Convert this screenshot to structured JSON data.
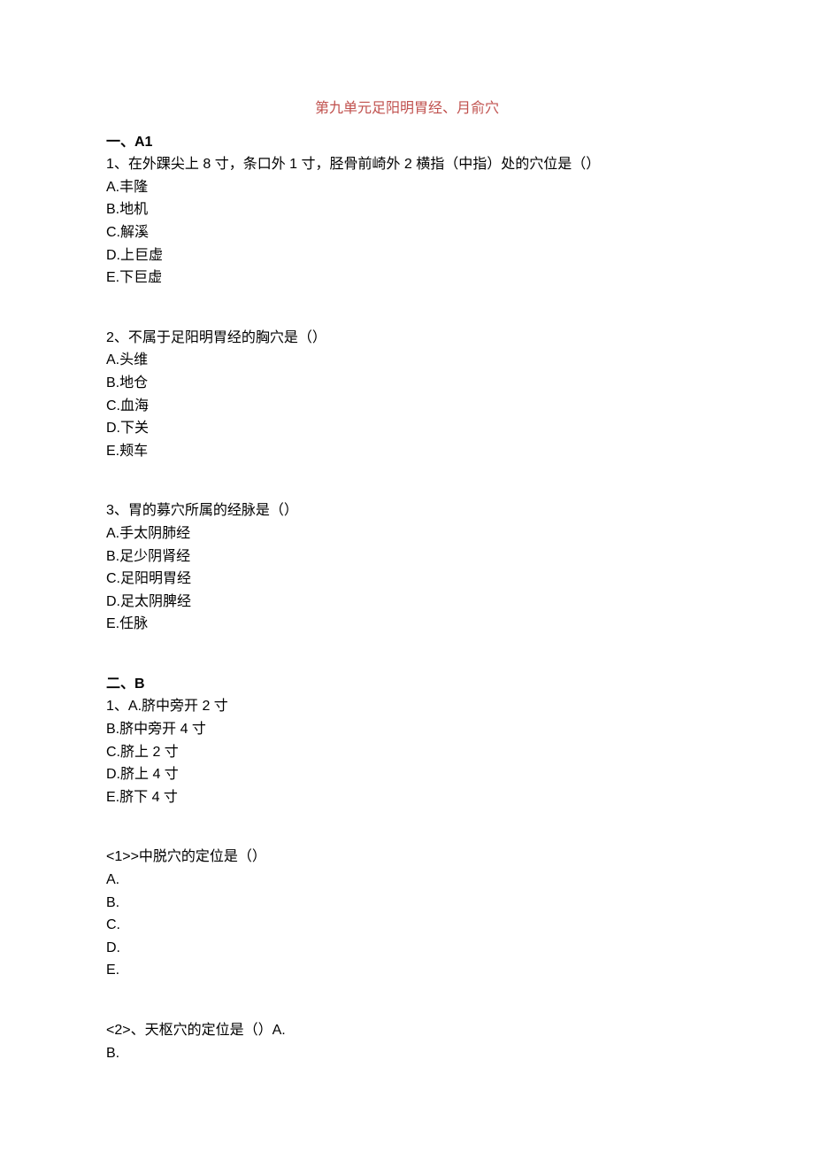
{
  "title": "第九单元足阳明胃经、月俞穴",
  "sectionA": {
    "header": "一、A1",
    "questions": [
      {
        "text": "1、在外踝尖上 8 寸，条口外 1 寸，胫骨前崎外 2 横指（中指）处的穴位是（）",
        "options": [
          "A.丰隆",
          "B.地机",
          "C.解溪",
          "D.上巨虚",
          "E.下巨虚"
        ]
      },
      {
        "text": "2、不属于足阳明胃经的胸穴是（）",
        "options": [
          "A.头维",
          "B.地仓",
          "C.血海",
          "D.下关",
          "E.颊车"
        ]
      },
      {
        "text": "3、胃的募穴所属的经脉是（）",
        "options": [
          "A.手太阴肺经",
          "B.足少阴肾经",
          "C.足阳明胃经",
          "D.足太阴脾经",
          "E.任脉"
        ]
      }
    ]
  },
  "sectionB": {
    "header": "二、B",
    "shared": {
      "text": "1、A.脐中旁开 2 寸",
      "options": [
        "B.脐中旁开 4 寸",
        "C.脐上 2 寸",
        "D.脐上 4 寸",
        "E.脐下 4 寸"
      ]
    },
    "subquestions": [
      {
        "text": "<1>>中脱穴的定位是（）",
        "options": [
          "A.",
          "B.",
          "C.",
          "D.",
          "E."
        ]
      },
      {
        "text": "<2>、天枢穴的定位是（）A.",
        "options": [
          "B."
        ]
      }
    ]
  }
}
